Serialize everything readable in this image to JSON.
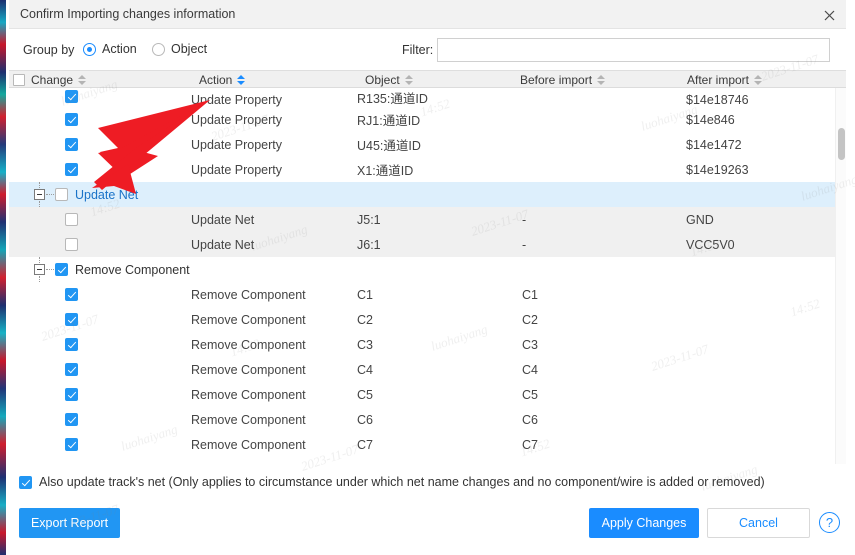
{
  "window": {
    "title": "Confirm Importing changes information",
    "close_icon": "close-icon"
  },
  "toolbar": {
    "group_by_label": "Group by",
    "options": [
      {
        "label": "Action",
        "selected": true
      },
      {
        "label": "Object",
        "selected": false
      }
    ],
    "filter_label": "Filter:",
    "filter_value": "",
    "filter_placeholder": ""
  },
  "table": {
    "columns": [
      {
        "key": "change",
        "label": "Change",
        "sort": "none",
        "has_checkbox": true
      },
      {
        "key": "action",
        "label": "Action",
        "sort": "active"
      },
      {
        "key": "object",
        "label": "Object",
        "sort": "none"
      },
      {
        "key": "before",
        "label": "Before import",
        "sort": "none"
      },
      {
        "key": "after",
        "label": "After import",
        "sort": "none"
      }
    ],
    "rows": [
      {
        "kind": "item",
        "checked": true,
        "action": "Update Property",
        "object": "R135:通道ID",
        "before": "",
        "after": "$14e18746",
        "clipped": true
      },
      {
        "kind": "item",
        "checked": true,
        "action": "Update Property",
        "object": "RJ1:通道ID",
        "before": "",
        "after": "$14e846"
      },
      {
        "kind": "item",
        "checked": true,
        "action": "Update Property",
        "object": "U45:通道ID",
        "before": "",
        "after": "$14e1472"
      },
      {
        "kind": "item",
        "checked": true,
        "action": "Update Property",
        "object": "X1:通道ID",
        "before": "",
        "after": "$14e19263"
      },
      {
        "kind": "group",
        "checked": false,
        "label": "Update Net",
        "selected": true,
        "link": true
      },
      {
        "kind": "item",
        "checked": false,
        "action": "Update Net",
        "object": "J5:1",
        "before": "-",
        "after": "GND",
        "shaded": true
      },
      {
        "kind": "item",
        "checked": false,
        "action": "Update Net",
        "object": "J6:1",
        "before": "-",
        "after": "VCC5V0",
        "shaded": true
      },
      {
        "kind": "group",
        "checked": true,
        "label": "Remove Component",
        "selected": false,
        "link": false
      },
      {
        "kind": "item",
        "checked": true,
        "action": "Remove Component",
        "object": "C1",
        "before": "C1",
        "after": ""
      },
      {
        "kind": "item",
        "checked": true,
        "action": "Remove Component",
        "object": "C2",
        "before": "C2",
        "after": ""
      },
      {
        "kind": "item",
        "checked": true,
        "action": "Remove Component",
        "object": "C3",
        "before": "C3",
        "after": ""
      },
      {
        "kind": "item",
        "checked": true,
        "action": "Remove Component",
        "object": "C4",
        "before": "C4",
        "after": ""
      },
      {
        "kind": "item",
        "checked": true,
        "action": "Remove Component",
        "object": "C5",
        "before": "C5",
        "after": ""
      },
      {
        "kind": "item",
        "checked": true,
        "action": "Remove Component",
        "object": "C6",
        "before": "C6",
        "after": ""
      },
      {
        "kind": "item",
        "checked": true,
        "action": "Remove Component",
        "object": "C7",
        "before": "C7",
        "after": ""
      }
    ]
  },
  "footer": {
    "track_net_checkbox": {
      "checked": true,
      "label": "Also update track's net (Only applies to circumstance under which net name changes and no component/wire is added or removed)"
    },
    "export_label": "Export Report",
    "apply_label": "Apply Changes",
    "cancel_label": "Cancel",
    "help_icon": "question-mark-icon",
    "help_glyph": "?"
  },
  "annotation": {
    "arrow_color": "#ee1c24",
    "arrow_name": "red-pointer-arrow"
  },
  "colors": {
    "accent": "#2196f3",
    "link": "#1a73c8",
    "selected_row": "#ddeffc",
    "shaded_row": "#f0f0f0",
    "header_bg": "#f0f0f0"
  },
  "watermarks": [
    "luohaiyang",
    "2023-11-07",
    "14:52",
    "luohaiyang",
    "2023-11-07",
    "14:52",
    "luohaiyang",
    "2023-11-07",
    "14:52",
    "luohaiyang",
    "2023-11-07",
    "14:52",
    "luohaiyang",
    "2023-11-07",
    "14:52",
    "luohaiyang",
    "2023-11-07",
    "14:52",
    "luohaiyang",
    "2023-11-07"
  ]
}
